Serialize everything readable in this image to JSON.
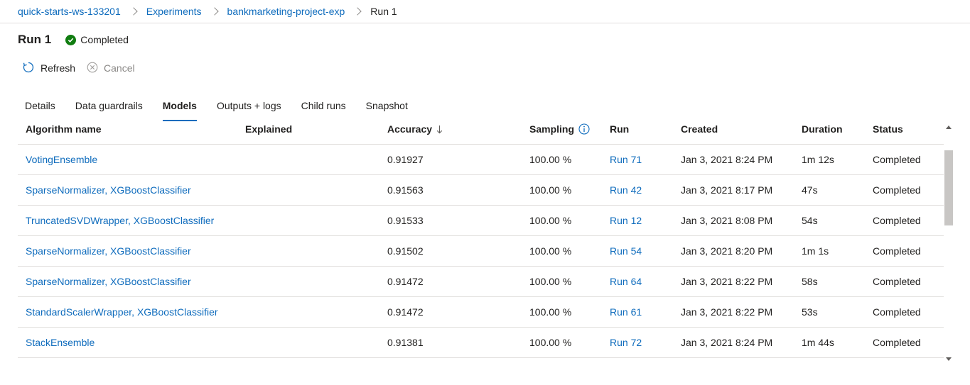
{
  "breadcrumb": [
    "quick-starts-ws-133201",
    "Experiments",
    "bankmarketing-project-exp",
    "Run 1"
  ],
  "page": {
    "title": "Run 1",
    "status": "Completed"
  },
  "toolbar": {
    "refresh": "Refresh",
    "cancel": "Cancel"
  },
  "tabs": [
    "Details",
    "Data guardrails",
    "Models",
    "Outputs + logs",
    "Child runs",
    "Snapshot"
  ],
  "active_tab": "Models",
  "table": {
    "headers": {
      "algorithm": "Algorithm name",
      "explained": "Explained",
      "accuracy": "Accuracy",
      "sampling": "Sampling",
      "run": "Run",
      "created": "Created",
      "duration": "Duration",
      "status": "Status"
    },
    "sort": {
      "column": "Accuracy",
      "direction": "descending"
    },
    "rows": [
      {
        "algorithm": "VotingEnsemble",
        "explained": "",
        "accuracy": "0.91927",
        "sampling": "100.00 %",
        "run": "Run 71",
        "created": "Jan 3, 2021 8:24 PM",
        "duration": "1m 12s",
        "status": "Completed"
      },
      {
        "algorithm": "SparseNormalizer, XGBoostClassifier",
        "explained": "",
        "accuracy": "0.91563",
        "sampling": "100.00 %",
        "run": "Run 42",
        "created": "Jan 3, 2021 8:17 PM",
        "duration": "47s",
        "status": "Completed"
      },
      {
        "algorithm": "TruncatedSVDWrapper, XGBoostClassifier",
        "explained": "",
        "accuracy": "0.91533",
        "sampling": "100.00 %",
        "run": "Run 12",
        "created": "Jan 3, 2021 8:08 PM",
        "duration": "54s",
        "status": "Completed"
      },
      {
        "algorithm": "SparseNormalizer, XGBoostClassifier",
        "explained": "",
        "accuracy": "0.91502",
        "sampling": "100.00 %",
        "run": "Run 54",
        "created": "Jan 3, 2021 8:20 PM",
        "duration": "1m 1s",
        "status": "Completed"
      },
      {
        "algorithm": "SparseNormalizer, XGBoostClassifier",
        "explained": "",
        "accuracy": "0.91472",
        "sampling": "100.00 %",
        "run": "Run 64",
        "created": "Jan 3, 2021 8:22 PM",
        "duration": "58s",
        "status": "Completed"
      },
      {
        "algorithm": "StandardScalerWrapper, XGBoostClassifier",
        "explained": "",
        "accuracy": "0.91472",
        "sampling": "100.00 %",
        "run": "Run 61",
        "created": "Jan 3, 2021 8:22 PM",
        "duration": "53s",
        "status": "Completed"
      },
      {
        "algorithm": "StackEnsemble",
        "explained": "",
        "accuracy": "0.91381",
        "sampling": "100.00 %",
        "run": "Run 72",
        "created": "Jan 3, 2021 8:24 PM",
        "duration": "1m 44s",
        "status": "Completed"
      }
    ]
  },
  "colors": {
    "link": "#0f6cbd",
    "success": "#107c10",
    "border": "#e1dfdd"
  },
  "icons": [
    "chevron-right-icon",
    "check-circle-icon",
    "refresh-icon",
    "cancel-icon",
    "sort-down-arrow-icon",
    "info-icon"
  ]
}
